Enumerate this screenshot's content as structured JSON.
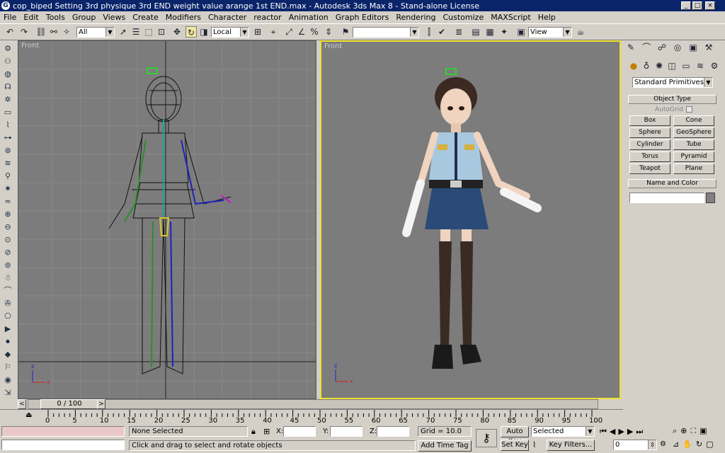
{
  "window": {
    "title": "cop_biped Setting 3rd physique 3rd END weight value arange 1st END.max - Autodesk 3ds Max 8 - Stand-alone License",
    "controls": [
      "_",
      "□",
      "×"
    ]
  },
  "menu": [
    "File",
    "Edit",
    "Tools",
    "Group",
    "Views",
    "Create",
    "Modifiers",
    "Character",
    "reactor",
    "Animation",
    "Graph Editors",
    "Rendering",
    "Customize",
    "MAXScript",
    "Help"
  ],
  "toolbar": {
    "selection_filter": "All",
    "ref_coord": "Local",
    "named_selection": "",
    "render_type": "View"
  },
  "viewports": {
    "left_label": "Front",
    "right_label": "Front"
  },
  "command_panel": {
    "category": "Standard Primitives",
    "object_type_title": "Object Type",
    "autogrid_label": "AutoGrid",
    "buttons": [
      "Box",
      "Cone",
      "Sphere",
      "GeoSphere",
      "Cylinder",
      "Tube",
      "Torus",
      "Pyramid",
      "Teapot",
      "Plane"
    ],
    "name_color_title": "Name and Color",
    "object_name": "",
    "object_color": "#808080"
  },
  "time_slider": {
    "position": "0 / 100",
    "prev": "<",
    "next": ">"
  },
  "track_ticks": [
    "0",
    "5",
    "10",
    "15",
    "20",
    "25",
    "30",
    "35",
    "40",
    "45",
    "50",
    "55",
    "60",
    "65",
    "70",
    "75",
    "80",
    "85",
    "90",
    "95",
    "100"
  ],
  "status": {
    "selection": "None Selected",
    "prompt": "Click and drag to select and rotate objects",
    "x_label": "X:",
    "y_label": "Y:",
    "z_label": "Z:",
    "x": "",
    "y": "",
    "z": "",
    "grid": "Grid = 10.0",
    "add_time_tag": "Add Time Tag",
    "auto_key": "Auto Key",
    "set_key": "Set Key",
    "key_mode": "Selected",
    "key_filters": "Key Filters...",
    "frame": "0"
  }
}
